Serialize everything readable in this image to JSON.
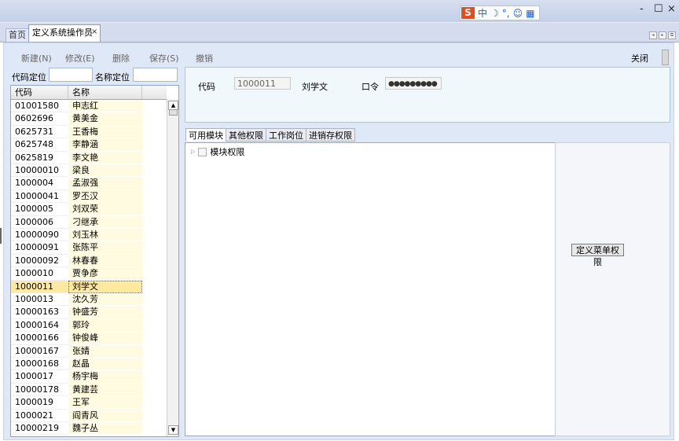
{
  "window": {
    "min": "-",
    "max": "☐",
    "close": "×"
  },
  "ime": {
    "logo": "S",
    "mode": "中",
    "icons": [
      "moon-icon",
      "punct-icon",
      "emoji-icon",
      "grid-icon"
    ],
    "moon": "☽",
    "punct": "°,",
    "emoji": "☺",
    "grid": "▦"
  },
  "tabs": {
    "home": "首页",
    "active": "定义系统操作员",
    "close": "×"
  },
  "toolbar": {
    "new": "新建(N)",
    "edit": "修改(E)",
    "delete": "删除",
    "save": "保存(S)",
    "undo": "撤销",
    "close": "关闭"
  },
  "search": {
    "code_label": "代码定位",
    "name_label": "名称定位",
    "code_value": "",
    "name_value": ""
  },
  "grid": {
    "headers": [
      "代码",
      "名称"
    ],
    "rows": [
      [
        "01001580",
        "申志红"
      ],
      [
        "0602696",
        "黄美金"
      ],
      [
        "0625731",
        "王香梅"
      ],
      [
        "0625748",
        "李静涵"
      ],
      [
        "0625819",
        "李文艳"
      ],
      [
        "10000010",
        "梁良"
      ],
      [
        "1000004",
        "孟淑强"
      ],
      [
        "10000041",
        "罗丕汉"
      ],
      [
        "1000005",
        "刘双荣"
      ],
      [
        "1000006",
        "刁继承"
      ],
      [
        "10000090",
        "刘玉林"
      ],
      [
        "10000091",
        "张陈平"
      ],
      [
        "10000092",
        "林春春"
      ],
      [
        "1000010",
        "贾争彦"
      ],
      [
        "1000011",
        "刘学文"
      ],
      [
        "1000013",
        "沈久芳"
      ],
      [
        "10000163",
        "钟盛芳"
      ],
      [
        "10000164",
        "郭玲"
      ],
      [
        "10000166",
        "钟俊峰"
      ],
      [
        "10000167",
        "张婧"
      ],
      [
        "10000168",
        "赵晶"
      ],
      [
        "1000017",
        "杨宇梅"
      ],
      [
        "10000178",
        "黄建芸"
      ],
      [
        "1000019",
        "王军"
      ],
      [
        "1000021",
        "阎青风"
      ],
      [
        "10000219",
        "魏子丛"
      ]
    ],
    "selected_index": 14
  },
  "info": {
    "code_label": "代码",
    "code_value": "1000011",
    "name": "刘学文",
    "password_label": "口令",
    "password_value": "●●●●●●●●●"
  },
  "subtabs": [
    "可用模块",
    "其他权限",
    "工作岗位",
    "进销存权限"
  ],
  "tree": {
    "root_label": "模块权限"
  },
  "menu_button": "定义菜单权限"
}
